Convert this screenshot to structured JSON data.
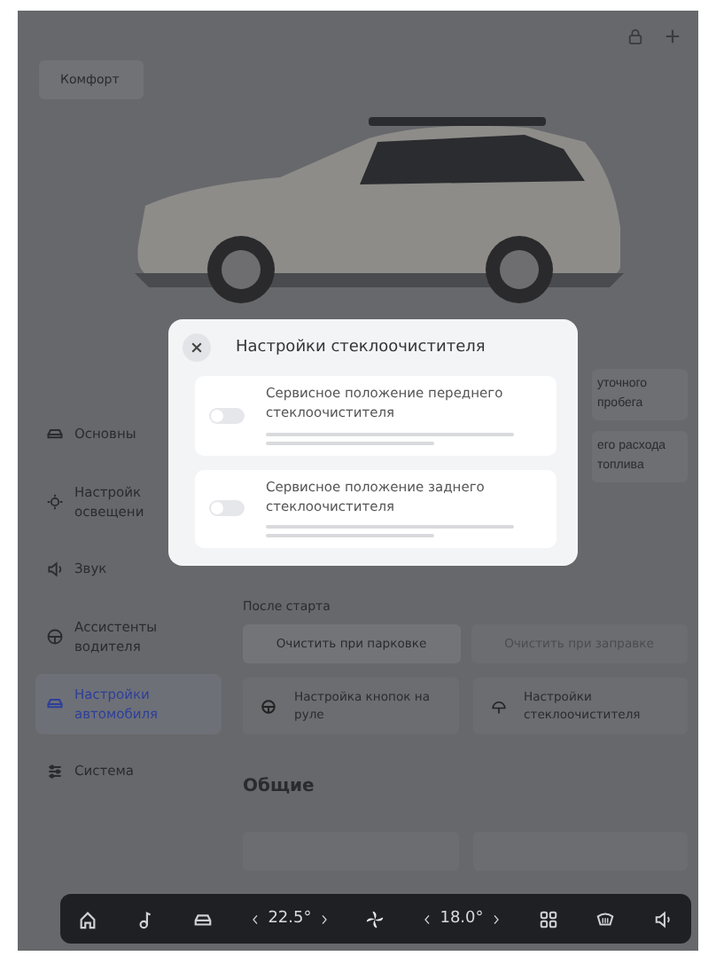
{
  "header": {
    "profile_button": "Комфорт"
  },
  "sidebar": {
    "items": [
      {
        "label": "Основны",
        "selected": false
      },
      {
        "label": "Настройк освещени",
        "selected": false
      },
      {
        "label": "Звук",
        "selected": false
      },
      {
        "label": "Ассистенты водителя",
        "selected": false
      },
      {
        "label": "Настройки автомобиля",
        "selected": true
      },
      {
        "label": "Система",
        "selected": false
      }
    ]
  },
  "cards_top": [
    {
      "label": "уточного пробега"
    },
    {
      "label": "его расхода топлива"
    }
  ],
  "after_start": {
    "title": "После старта",
    "options": [
      {
        "label": "Очистить при парковке",
        "selected": true
      },
      {
        "label": "Очистить при заправке",
        "selected": false
      }
    ],
    "cards": [
      {
        "label": "Настройка кнопок на руле"
      },
      {
        "label": "Настройки стеклоочистителя"
      }
    ]
  },
  "general": {
    "title": "Общие"
  },
  "dialog": {
    "title": "Настройки стеклоочистителя",
    "options": [
      {
        "title": "Сервисное положение переднего стеклоочистителя",
        "on": false
      },
      {
        "title": "Сервисное положение заднего стеклоочистителя",
        "on": false
      }
    ]
  },
  "dock": {
    "left_temp": "22.5°",
    "right_temp": "18.0°"
  }
}
